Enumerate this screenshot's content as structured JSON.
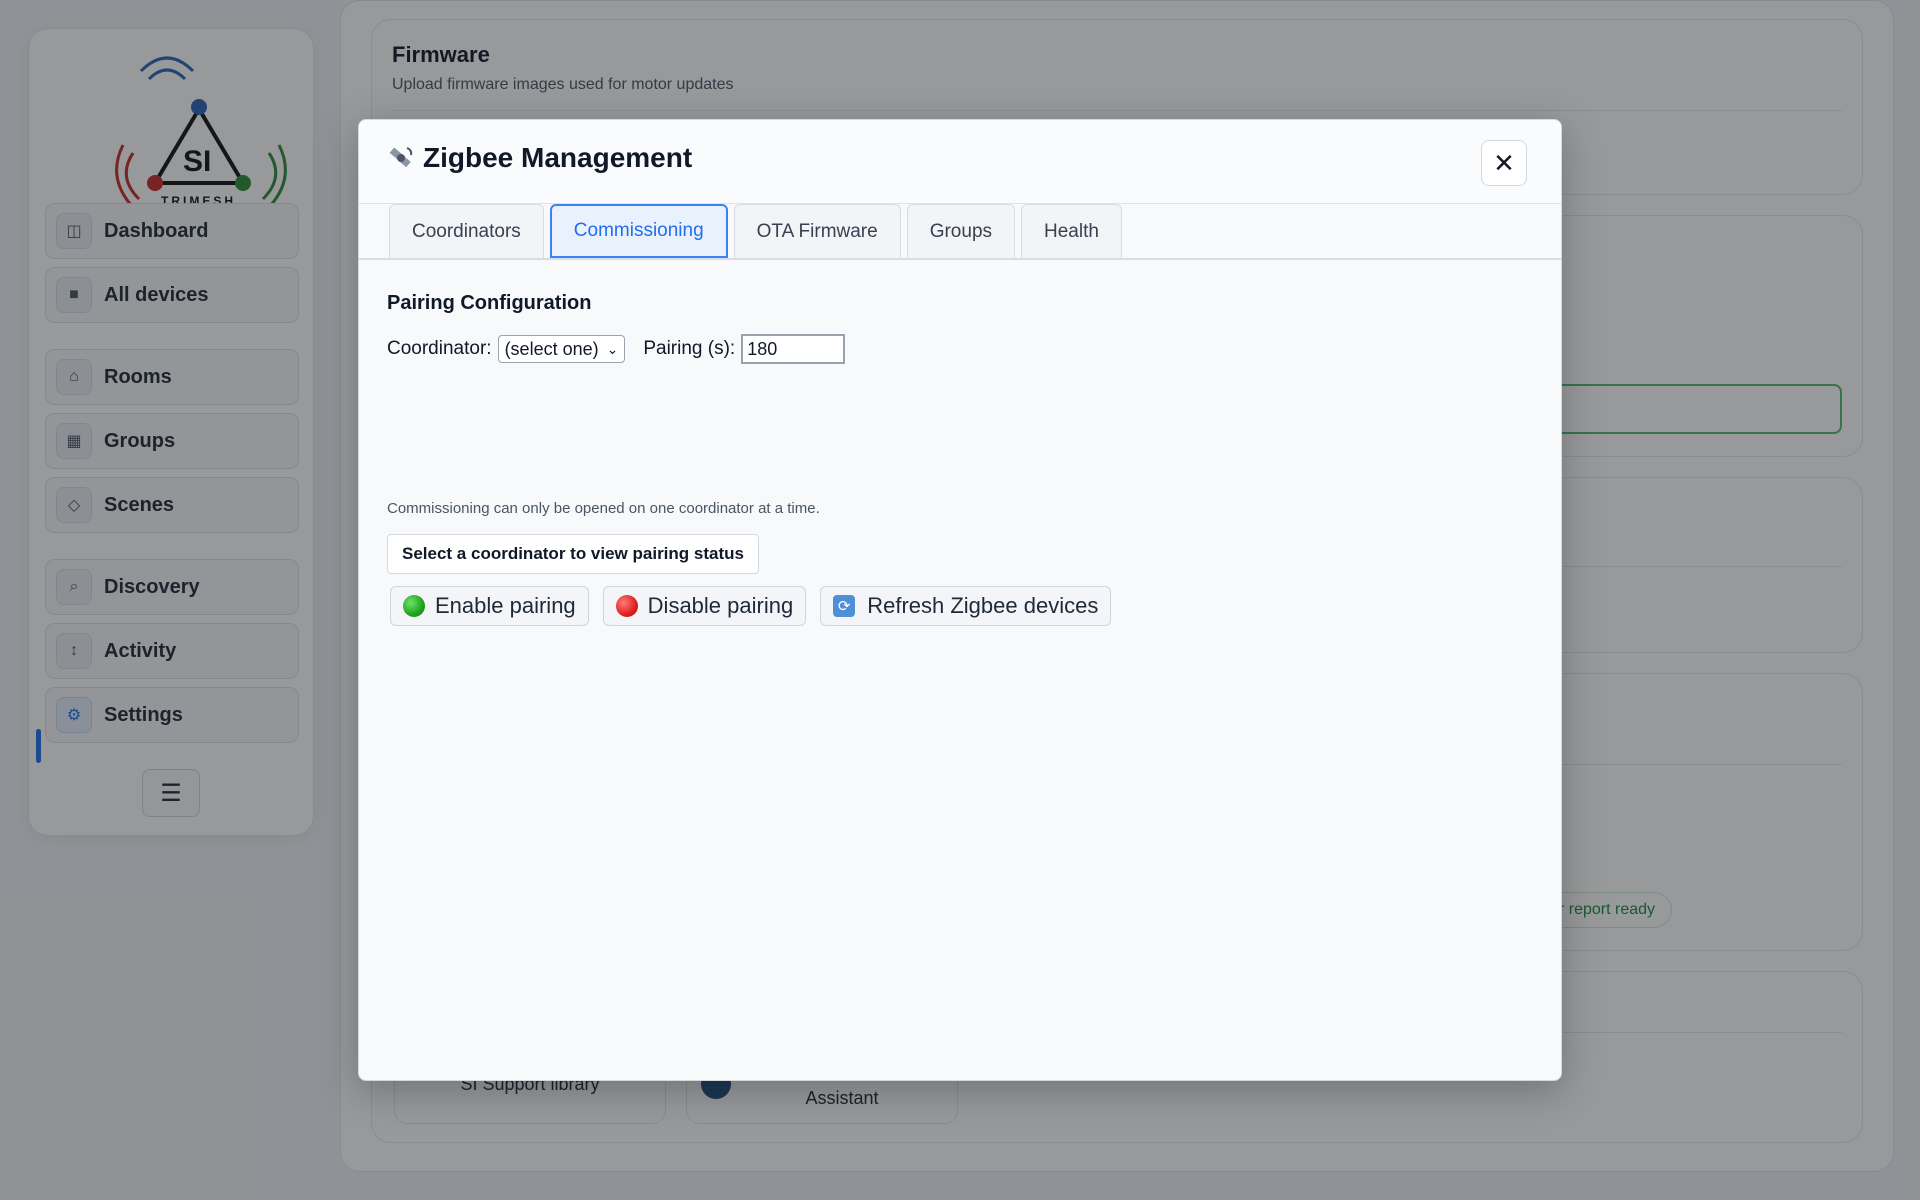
{
  "sidebar": {
    "brand": "TRIMESH",
    "items": [
      {
        "label": "Dashboard",
        "icon": "layout-icon"
      },
      {
        "label": "All devices",
        "icon": "square-icon"
      },
      {
        "label": "Rooms",
        "icon": "home-icon"
      },
      {
        "label": "Groups",
        "icon": "grid-icon"
      },
      {
        "label": "Scenes",
        "icon": "diamond-icon"
      },
      {
        "label": "Discovery",
        "icon": "search-icon"
      },
      {
        "label": "Activity",
        "icon": "arrows-icon"
      },
      {
        "label": "Settings",
        "icon": "gear-icon",
        "active": true
      }
    ],
    "menu_icon": "hamburger-icon"
  },
  "background": {
    "firmware_title": "Firmware",
    "firmware_sub": "Upload firmware images used for motor updates",
    "report_pill": "r report ready",
    "support_library": "SI Support library",
    "assistant": "Assistant"
  },
  "modal": {
    "title": "Zigbee Management",
    "title_icon": "satellite-icon",
    "close_label": "✕",
    "tabs": [
      "Coordinators",
      "Commissioning",
      "OTA Firmware",
      "Groups",
      "Health"
    ],
    "active_tab": "Commissioning",
    "section_title": "Pairing Configuration",
    "coordinator_label": "Coordinator:",
    "coordinator_value": "(select one)",
    "pairing_label": "Pairing (s):",
    "pairing_value": "180",
    "note": "Commissioning can only be opened on one coordinator at a time.",
    "status_text": "Select a coordinator to view pairing status",
    "buttons": {
      "enable": "Enable pairing",
      "disable": "Disable pairing",
      "refresh": "Refresh Zigbee devices"
    }
  },
  "colors": {
    "accent": "#1f6feb",
    "green_status": "#1ea31e",
    "red_status": "#e0201f"
  }
}
